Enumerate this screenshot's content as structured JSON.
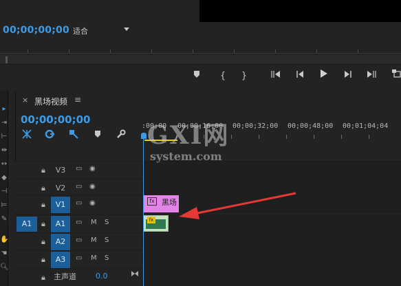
{
  "monitor": {
    "timecode": "00;00;00;00",
    "fit_value": "适合",
    "transport_icons": [
      "marker-icon",
      "mark-in-icon",
      "mark-out-icon",
      "go-to-in-icon",
      "step-back-icon",
      "play-icon",
      "step-forward-icon",
      "go-to-out-icon",
      "lift-icon"
    ]
  },
  "timeline": {
    "tab_close": "×",
    "tab_title": "黑场视频",
    "tab_menu": "≡",
    "timecode": "00;00;00;00",
    "ruler_labels": [
      ":00;00",
      "00;00;16;00",
      "00;00;32;00",
      "00;00;48;00",
      "00;01;04;04"
    ],
    "tracks": [
      {
        "name": "V3",
        "source": "",
        "selected": false,
        "type": "video"
      },
      {
        "name": "V2",
        "source": "",
        "selected": false,
        "type": "video"
      },
      {
        "name": "V1",
        "source": "",
        "selected": true,
        "type": "video"
      },
      {
        "name": "A1",
        "source": "A1",
        "selected": true,
        "type": "audio"
      },
      {
        "name": "A2",
        "source": "",
        "selected": true,
        "type": "audio"
      },
      {
        "name": "A3",
        "source": "",
        "selected": true,
        "type": "audio"
      }
    ],
    "audio_m": "M",
    "audio_s": "S",
    "master_label": "主声道",
    "master_value": "0.0",
    "video_clip_label": "黑场",
    "fx_label": "fx"
  },
  "watermark": {
    "logo": "GXI网",
    "text": "system.com"
  },
  "colors": {
    "accent": "#3b9be6",
    "video_clip": "#e384e6",
    "audio_clip": "#2f7a4f",
    "work_area": "#e8d300",
    "arrow": "#e53935"
  }
}
